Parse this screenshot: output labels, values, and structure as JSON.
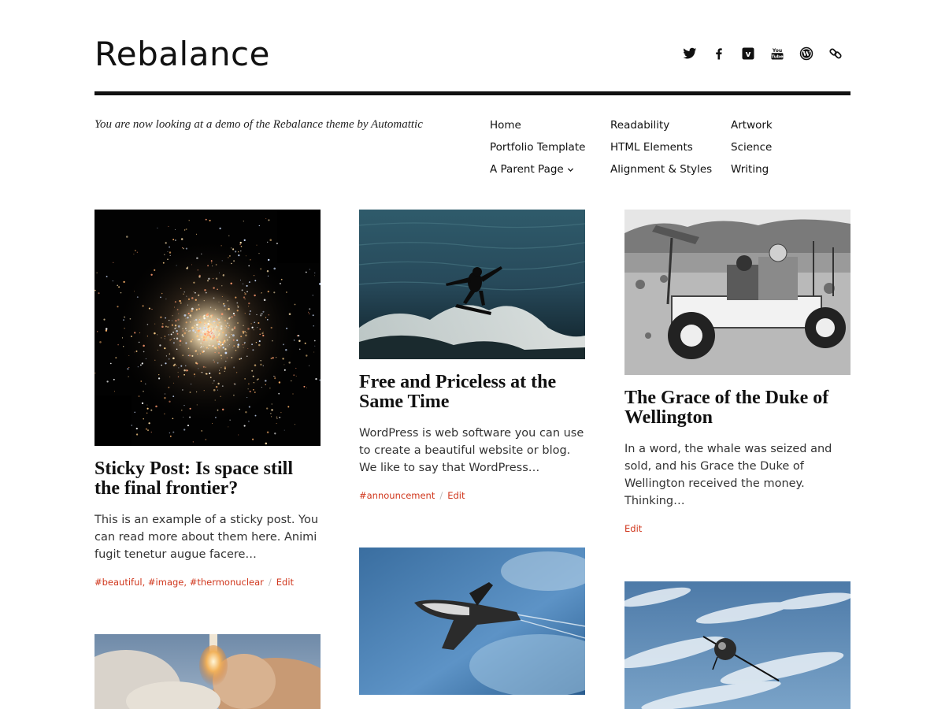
{
  "site": {
    "title": "Rebalance",
    "tagline": "You are now looking at a demo of the Rebalance theme by Automattic"
  },
  "social": [
    {
      "icon": "twitter-icon"
    },
    {
      "icon": "facebook-icon"
    },
    {
      "icon": "vimeo-icon"
    },
    {
      "icon": "youtube-icon"
    },
    {
      "icon": "wordpress-icon"
    },
    {
      "icon": "link-icon"
    }
  ],
  "menu": {
    "col1": [
      "Home",
      "Portfolio Template",
      "A Parent Page"
    ],
    "col2": [
      "Readability",
      "HTML Elements",
      "Alignment & Styles"
    ],
    "col3": [
      "Artwork",
      "Science",
      "Writing"
    ]
  },
  "posts": [
    {
      "title": "Sticky Post: Is space still the final frontier?",
      "excerpt": "This is an example of a sticky post. You can read more about them here. Animi fugit tenetur augue facere…",
      "tags": [
        "#beautiful",
        "#image",
        "#thermonuclear"
      ],
      "edit": "Edit"
    },
    {
      "title": "Free and Priceless at the Same Time",
      "excerpt": "WordPress is web software you can use to create a beautiful website or blog. We like to say that WordPress…",
      "tags": [
        "#announcement"
      ],
      "edit": "Edit"
    },
    {
      "title": "The Grace of the Duke of Wellington",
      "excerpt": "In a word, the whale was seized and sold, and his Grace the Duke of Wellington received the money. Thinking…",
      "tags": [],
      "edit": "Edit"
    }
  ],
  "colors": {
    "accent": "#d0371d",
    "text": "#111111"
  }
}
